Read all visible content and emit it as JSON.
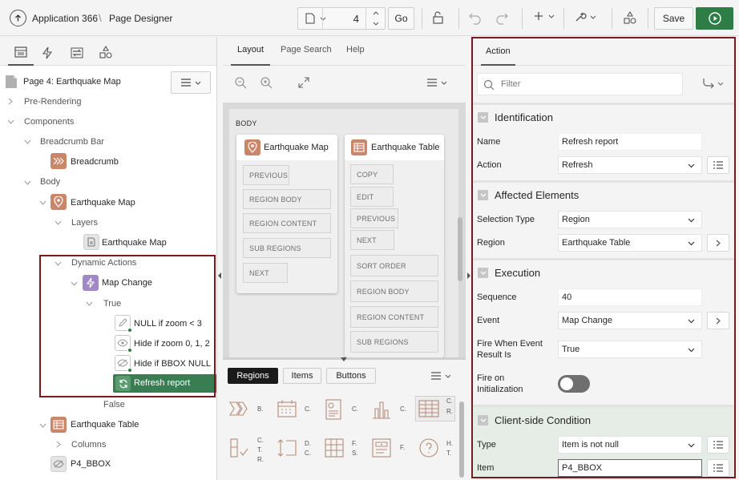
{
  "topbar": {
    "app_label": "Application 366",
    "separator": "\\",
    "designer_label": "Page Designer",
    "page_number": "4",
    "go_label": "Go",
    "save_label": "Save"
  },
  "left": {
    "tree": [
      {
        "label": "Page 4: Earthquake Map"
      },
      {
        "label": "Pre-Rendering"
      },
      {
        "label": "Components"
      },
      {
        "label": "Breadcrumb Bar"
      },
      {
        "label": "Breadcrumb"
      },
      {
        "label": "Body"
      },
      {
        "label": "Earthquake Map"
      },
      {
        "label": "Layers"
      },
      {
        "label": "Earthquake Map"
      },
      {
        "label": "Dynamic Actions"
      },
      {
        "label": "Map Change"
      },
      {
        "label": "True"
      },
      {
        "label": "NULL if zoom < 3"
      },
      {
        "label": "Hide if zoom 0, 1, 2"
      },
      {
        "label": "Hide if BBOX NULL"
      },
      {
        "label": "Refresh report"
      },
      {
        "label": "False"
      },
      {
        "label": "Earthquake Table"
      },
      {
        "label": "Columns"
      },
      {
        "label": "P4_BBOX"
      }
    ]
  },
  "middle": {
    "tabs": [
      "Layout",
      "Page Search",
      "Help"
    ],
    "body_label": "BODY",
    "card_map": {
      "title": "Earthquake Map",
      "slots": [
        "PREVIOUS",
        "REGION BODY",
        "REGION CONTENT",
        "SUB REGIONS",
        "NEXT"
      ]
    },
    "card_table": {
      "title": "Earthquake Table",
      "slots": [
        "COPY",
        "EDIT",
        "PREVIOUS",
        "NEXT",
        "SORT ORDER",
        "REGION BODY",
        "REGION CONTENT",
        "SUB REGIONS"
      ]
    },
    "palette_tabs": [
      "Regions",
      "Items",
      "Buttons"
    ],
    "palette_labels": [
      "B.",
      "C.",
      "C.",
      "C.",
      "C.",
      "R.",
      "C.",
      "T.",
      "R.",
      "D.",
      "C.",
      "F.",
      "S.",
      "F.",
      "H.",
      "T."
    ]
  },
  "right": {
    "tab": "Action",
    "filter_placeholder": "Filter",
    "sections": {
      "identification": "Identification",
      "affected": "Affected Elements",
      "execution": "Execution",
      "client": "Client-side Condition"
    },
    "fields": {
      "name_label": "Name",
      "name_value": "Refresh report",
      "action_label": "Action",
      "action_value": "Refresh",
      "seltype_label": "Selection Type",
      "seltype_value": "Region",
      "region_label": "Region",
      "region_value": "Earthquake Table",
      "sequence_label": "Sequence",
      "sequence_value": "40",
      "event_label": "Event",
      "event_value": "Map Change",
      "fire_label_1": "Fire When Event",
      "fire_label_2": "Result Is",
      "fire_value": "True",
      "fireinit_label_1": "Fire on",
      "fireinit_label_2": "Initialization",
      "type_label": "Type",
      "type_value": "Item is not null",
      "item_label": "Item",
      "item_value": "P4_BBOX"
    }
  },
  "colors": {
    "highlight_border": "#7a1b1b",
    "selected_node": "#3b7d52",
    "run_button": "#2e7d46",
    "region_icon": "#c9866a",
    "action_icon": "#a389c4"
  }
}
